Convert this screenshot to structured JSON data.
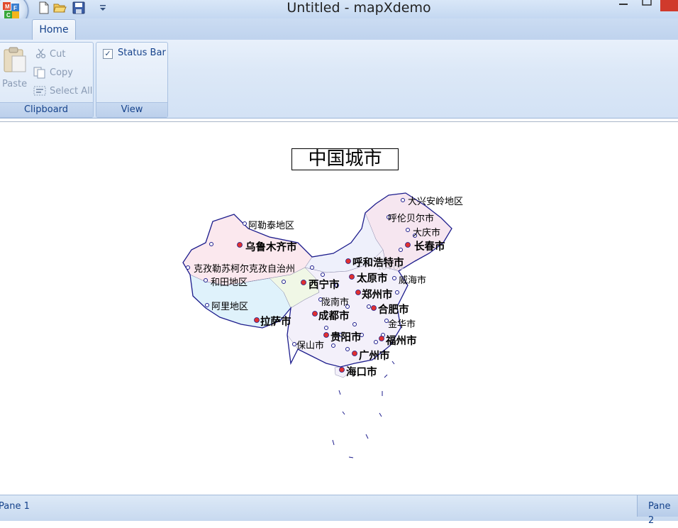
{
  "window": {
    "title": "Untitled - mapXdemo"
  },
  "ribbon": {
    "tabs": [
      {
        "label": "Home"
      }
    ],
    "clipboard": {
      "group_label": "Clipboard",
      "paste": "Paste",
      "cut": "Cut",
      "copy": "Copy",
      "select_all": "Select All"
    },
    "view": {
      "group_label": "View",
      "status_bar": "Status Bar",
      "status_bar_checked": true
    }
  },
  "map": {
    "title": "中国城市",
    "labels": {
      "daxinganling": "大兴安岭地区",
      "hulunbeier": "呼伦贝尔市",
      "daqing": "大庆市",
      "changchun": "长春市",
      "aletai": "阿勒泰地区",
      "wulumuqi": "乌鲁木齐市",
      "huhehaote": "呼和浩特市",
      "kezilesu": "克孜勒苏柯尔克孜自治州",
      "taiyuan": "太原市",
      "weihai": "威海市",
      "hetian": "和田地区",
      "xining": "西宁市",
      "zhengzhou": "郑州市",
      "longnan": "陇南市",
      "ali": "阿里地区",
      "hefei": "合肥市",
      "chengdu": "成都市",
      "lasa": "拉萨市",
      "jinhua": "金华市",
      "guiyang": "贵阳市",
      "fuzhou": "福州市",
      "baoshan": "保山市",
      "guangzhou": "广州市",
      "haikou": "海口市"
    }
  },
  "status": {
    "pane1": "Pane 1",
    "pane2": "Pane 2"
  },
  "colors": {
    "ribbon_text": "#15428b",
    "close_button": "#d03a2c",
    "map_border": "#1c1c8c",
    "city_dot": "#e03030"
  }
}
